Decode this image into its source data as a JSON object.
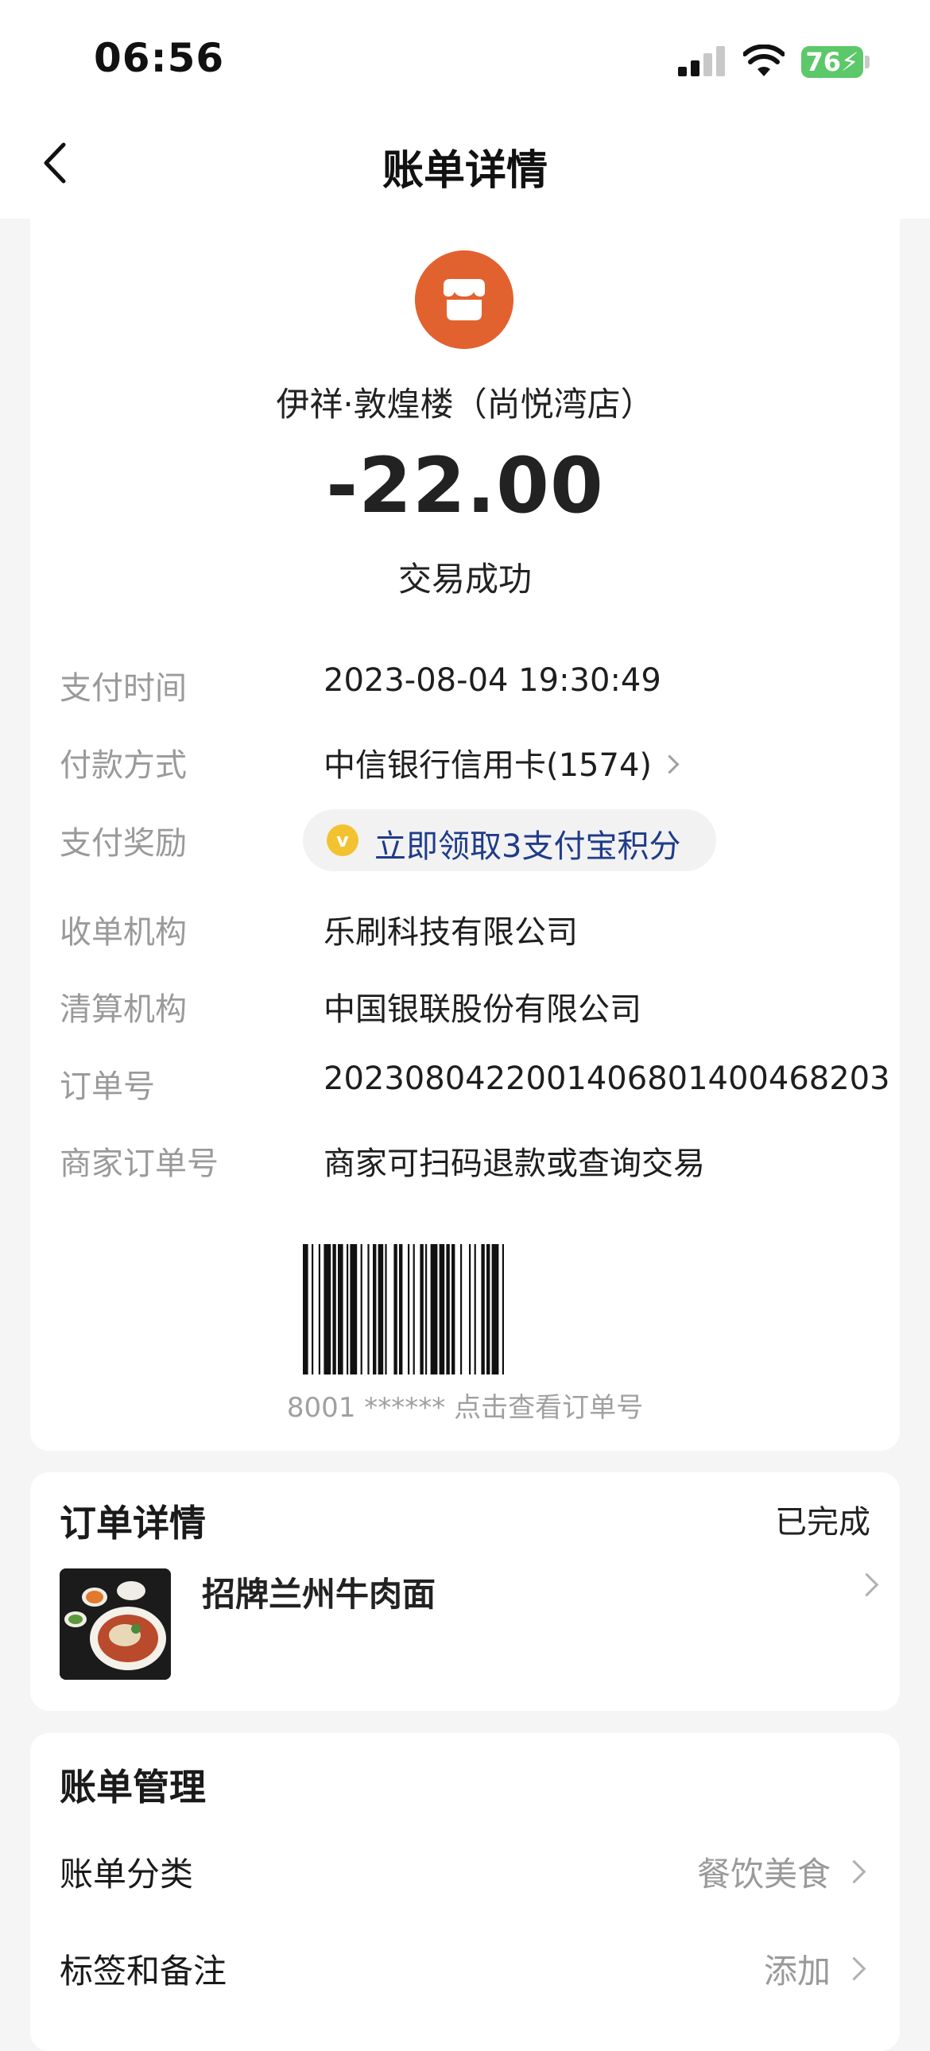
{
  "status_bar": {
    "time": "06:56",
    "battery": "76"
  },
  "header": {
    "title": "账单详情"
  },
  "transaction": {
    "merchant_name": "伊祥·敦煌楼（尚悦湾店）",
    "amount": "-22.00",
    "status": "交易成功"
  },
  "details": [
    {
      "label": "支付时间",
      "value": "2023-08-04 19:30:49"
    },
    {
      "label": "付款方式",
      "value": "中信银行信用卡(1574)"
    },
    {
      "label": "支付奖励",
      "value": "立即领取3支付宝积分"
    },
    {
      "label": "收单机构",
      "value": "乐刷科技有限公司"
    },
    {
      "label": "清算机构",
      "value": "中国银联股份有限公司"
    },
    {
      "label": "订单号",
      "value": "2023080422001406801400468203"
    },
    {
      "label": "商家订单号",
      "value": "商家可扫码退款或查询交易"
    }
  ],
  "barcode_caption": "8001 ****** 点击查看订单号",
  "order": {
    "title": "订单详情",
    "status": "已完成",
    "item_name": "招牌兰州牛肉面"
  },
  "manage": {
    "title": "账单管理",
    "rows": [
      {
        "label": "账单分类",
        "value": "餐饮美食"
      },
      {
        "label": "标签和备注",
        "value": "添加"
      }
    ]
  }
}
